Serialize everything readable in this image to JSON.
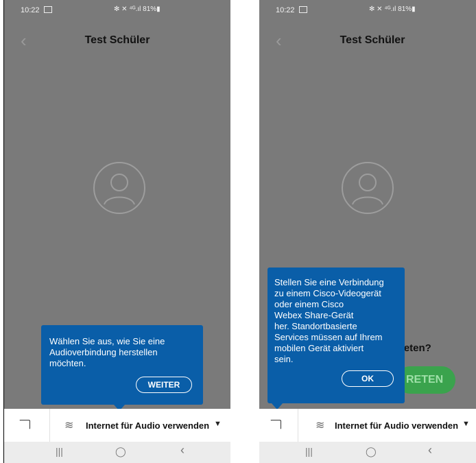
{
  "left": {
    "status_time": "10:22",
    "status_right": "✻ ✕ ⁴ᴳ.ıl 81%▮",
    "title": "Test Schüler",
    "tooltip_text": "Wählen Sie aus, wie Sie eine\nAudioverbindung herstellen\nmöchten.",
    "tooltip_button": "WEITER",
    "audio_label": "Internet für Audio verwenden",
    "nav_recent": "|||",
    "nav_home": "◯",
    "nav_back": "‹"
  },
  "right": {
    "status_time": "10:22",
    "status_right": "✻ ✕ ⁴ᴳ.ıl 81%▮",
    "title": "Test Schüler",
    "tooltip_text": "Stellen Sie eine Verbindung\nzu einem Cisco-Videogerät\noder einem Cisco\nWebex Share-Gerät\nher. Standortbasierte\nServices müssen auf Ihrem\nmobilen Gerät aktiviert\nsein.",
    "tooltip_button": "OK",
    "partial_question": "treten?",
    "partial_cta": "RETEN",
    "audio_label": "Internet für Audio verwenden",
    "nav_recent": "|||",
    "nav_home": "◯",
    "nav_back": "‹"
  },
  "colors": {
    "tooltip": "#0a5ea8",
    "overlay": "#7a7a7a",
    "cta": "#3aa34d"
  }
}
